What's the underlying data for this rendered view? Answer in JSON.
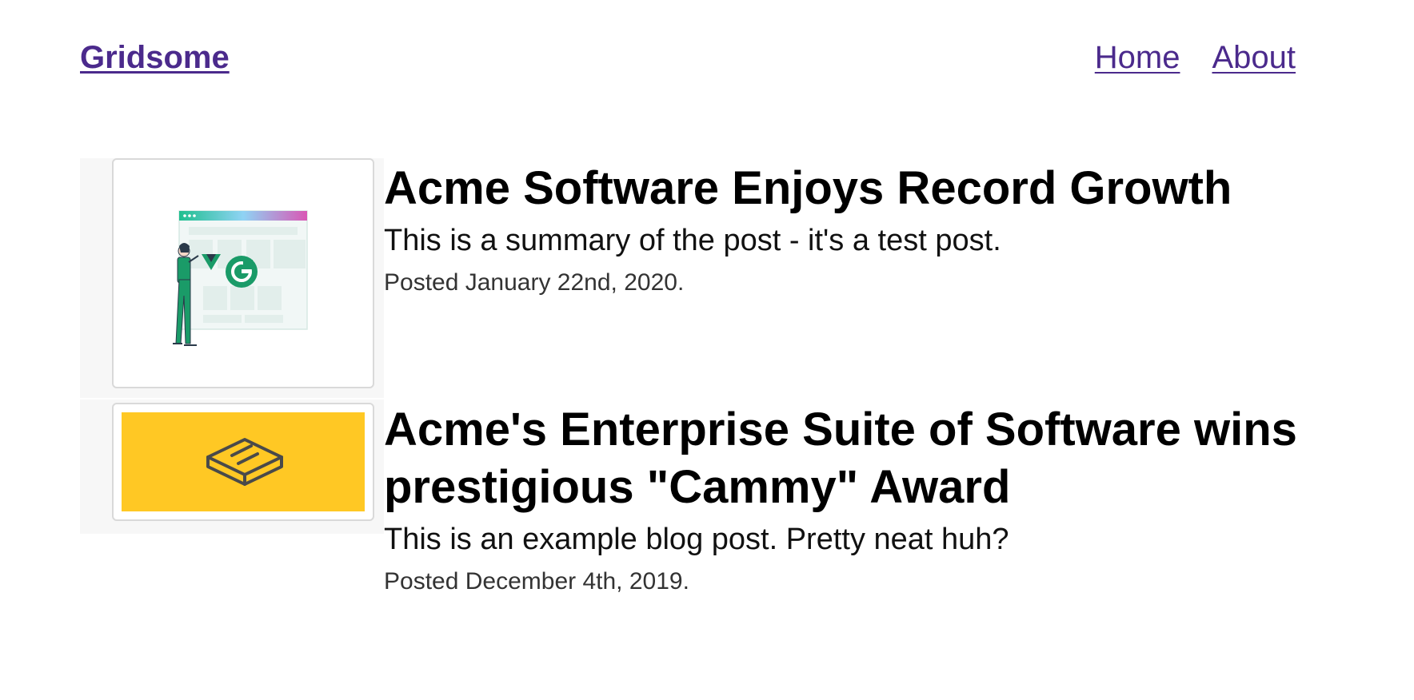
{
  "header": {
    "logo": "Gridsome",
    "nav": [
      {
        "label": "Home"
      },
      {
        "label": "About"
      }
    ]
  },
  "posts": [
    {
      "title": "Acme Software Enjoys Record Growth",
      "summary": "This is a summary of the post - it's a test post.",
      "date": "Posted January 22nd, 2020.",
      "thumbnail": "gridsome-illustration"
    },
    {
      "title": "Acme's Enterprise Suite of Software wins prestigious \"Cammy\" Award",
      "summary": "This is an example blog post. Pretty neat huh?",
      "date": "Posted December 4th, 2019.",
      "thumbnail": "yellow-box-logo"
    }
  ],
  "colors": {
    "link": "#4b2a8c",
    "thumb_yellow": "#ffc824",
    "accent_green": "#1a9b68"
  }
}
